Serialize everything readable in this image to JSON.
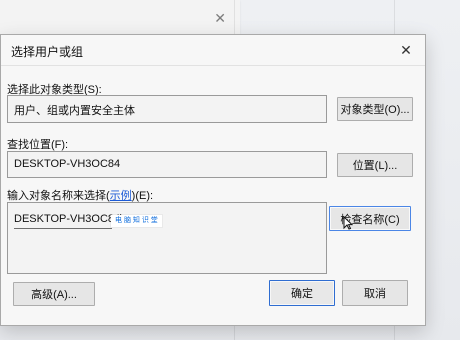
{
  "dialog": {
    "title": "选择用户或组",
    "labels": {
      "object_type": "选择此对象类型(S):",
      "from_location": "查找位置(F):",
      "enter_names_prefix": "输入对象名称来选择(",
      "enter_names_link": "示例",
      "enter_names_suffix": ")(E):"
    },
    "fields": {
      "object_type_value": "用户、组或内置安全主体",
      "location_value": "DESKTOP-VH3OC84",
      "entered_object_value": "DESKTOP-VH3OC84\\"
    },
    "buttons": {
      "object_types": "对象类型(O)...",
      "locations": "位置(L)...",
      "check_names": "检查名称(C)",
      "advanced": "高级(A)...",
      "ok": "确定",
      "cancel": "取消"
    },
    "overlay_watermark": "电 脑 知 识 堂"
  },
  "icons": {
    "close": "close-icon",
    "cursor": "mouse-cursor-icon"
  }
}
